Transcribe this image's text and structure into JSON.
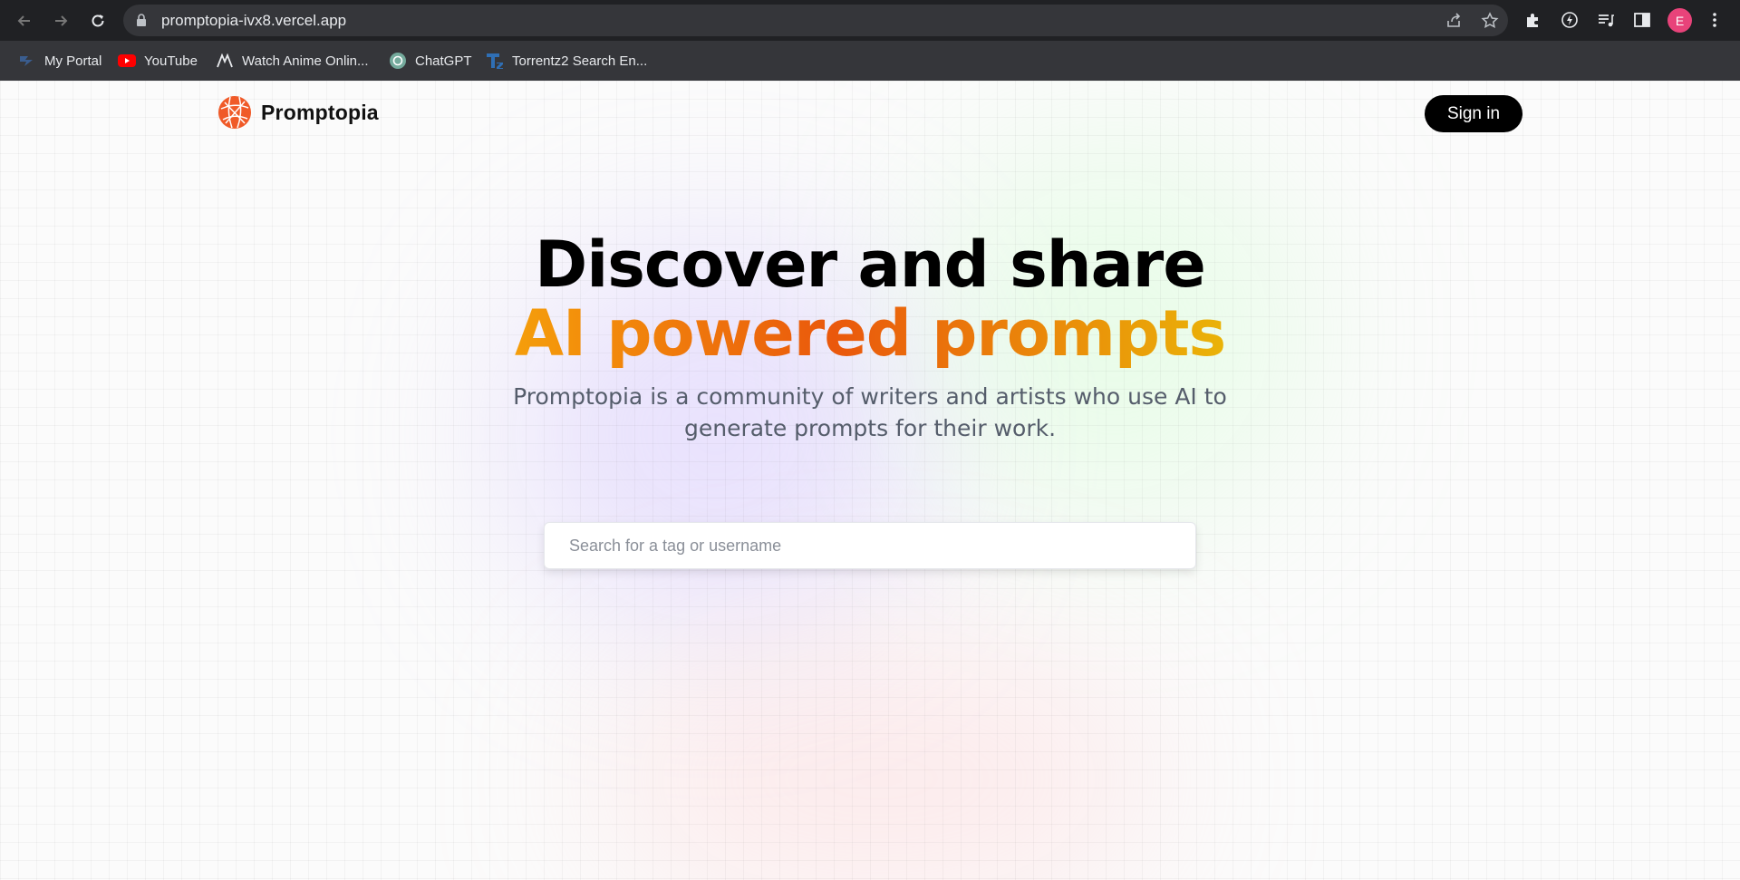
{
  "browser": {
    "url": "promptopia-ivx8.vercel.app",
    "profile_initial": "E",
    "profile_color": "#e8437a",
    "bookmarks": [
      {
        "label": "My Portal",
        "icon": "portal-icon"
      },
      {
        "label": "YouTube",
        "icon": "youtube-icon"
      },
      {
        "label": "Watch Anime Onlin...",
        "icon": "anime-icon"
      },
      {
        "label": "ChatGPT",
        "icon": "chatgpt-icon"
      },
      {
        "label": "Torrentz2 Search En...",
        "icon": "torrentz-icon"
      }
    ]
  },
  "header": {
    "brand": "Promptopia",
    "sign_in_label": "Sign in"
  },
  "hero": {
    "title_line1": "Discover and share",
    "title_line2": "AI powered prompts",
    "description": "Promptopia is a community of writers and artists who use AI to generate prompts for their work."
  },
  "search": {
    "placeholder": "Search for a tag or username",
    "value": ""
  },
  "colors": {
    "accent_orange": "#ea580c",
    "accent_amber": "#f59e0b",
    "button_bg": "#000000"
  }
}
